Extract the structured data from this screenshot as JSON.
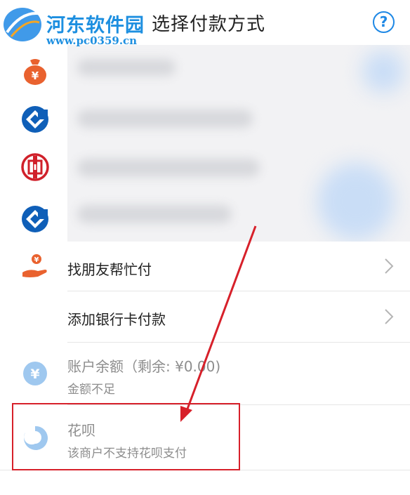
{
  "watermark": {
    "title": "河东软件园",
    "url": "www.pc0359.cn"
  },
  "header": {
    "title": "选择付款方式",
    "help_symbol": "?"
  },
  "methods": [
    {
      "icon": "money-bag-icon",
      "label": ""
    },
    {
      "icon": "ccb-bank-icon",
      "label": ""
    },
    {
      "icon": "icbc-bank-icon",
      "label": ""
    },
    {
      "icon": "ccb-bank-icon",
      "label": ""
    }
  ],
  "actions": {
    "friend_pay": "找朋友帮忙付",
    "add_bank_card": "添加银行卡付款"
  },
  "balance": {
    "label": "账户余额（剩余: ¥0.00)",
    "note": "金额不足"
  },
  "huabei": {
    "label": "花呗",
    "note": "该商户不支持花呗支付"
  },
  "colors": {
    "accent": "#1e88e5",
    "orange": "#e9622f",
    "red": "#d0202a",
    "disabled_blue": "#9fc8ef",
    "annotation_red": "#d7202a"
  }
}
